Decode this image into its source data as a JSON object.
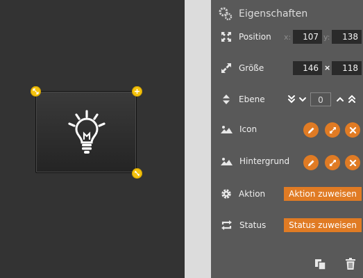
{
  "panel": {
    "title": "Eigenschaften",
    "position": {
      "label": "Position",
      "x_label": "x:",
      "y_label": "y:",
      "x": "107",
      "y": "138"
    },
    "size": {
      "label": "Größe",
      "width": "146",
      "times": "×",
      "height": "118"
    },
    "layer": {
      "label": "Ebene",
      "value": "0"
    },
    "icon": {
      "label": "Icon"
    },
    "background": {
      "label": "Hintergrund"
    },
    "action": {
      "label": "Aktion",
      "button": "Aktion zuweisen"
    },
    "status": {
      "label": "Status",
      "button": "Status zuweisen"
    }
  },
  "colors": {
    "accent": "#e07b24",
    "handle": "#f4c20d",
    "panel": "#595959",
    "canvas": "#333333"
  },
  "icons": [
    "gear-icon",
    "move-icon",
    "resize-icon",
    "sort-icon",
    "image-icon",
    "edit-icon",
    "expand-icon",
    "close-icon",
    "cog-icon",
    "refresh-icon",
    "copy-icon",
    "trash-icon",
    "lightbulb-icon"
  ]
}
